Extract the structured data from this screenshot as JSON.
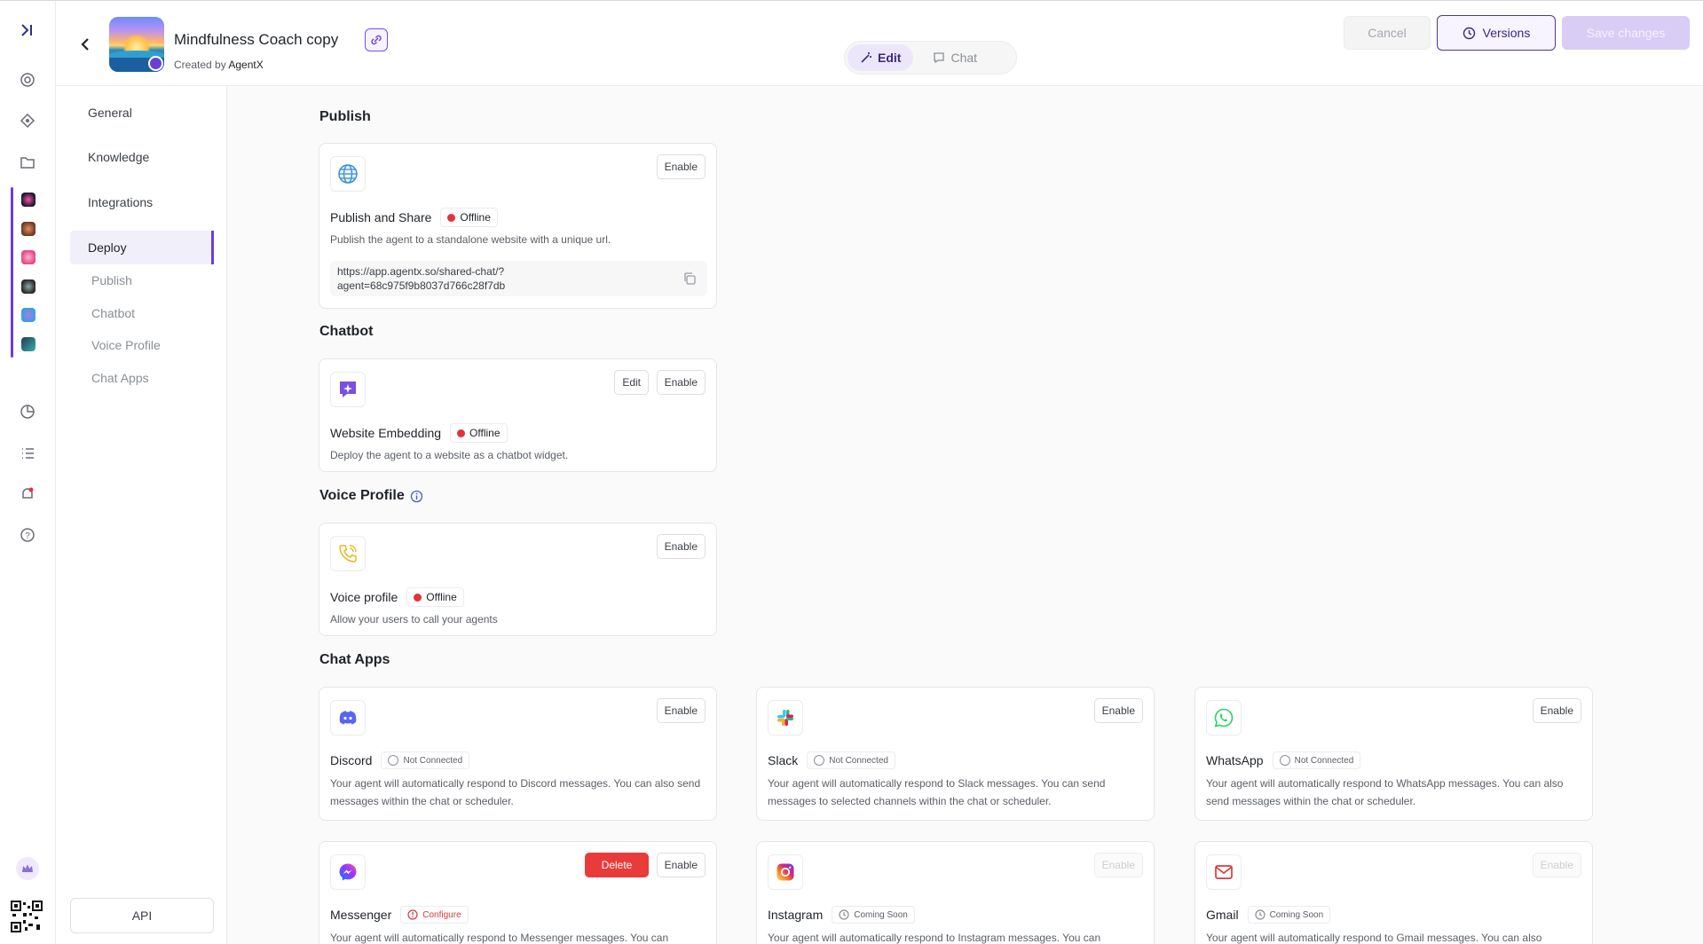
{
  "header": {
    "agent_name": "Mindfulness Coach copy",
    "created_prefix": "Created by",
    "created_by": "AgentX",
    "mode_edit": "Edit",
    "mode_chat": "Chat",
    "cancel": "Cancel",
    "versions": "Versions",
    "save": "Save changes"
  },
  "subnav": {
    "items": [
      "General",
      "Knowledge",
      "Integrations",
      "Deploy"
    ],
    "deploy_subitems": [
      "Publish",
      "Chatbot",
      "Voice Profile",
      "Chat Apps"
    ],
    "api": "API"
  },
  "sections": {
    "publish": "Publish",
    "chatbot": "Chatbot",
    "voice_profile": "Voice Profile",
    "chat_apps": "Chat Apps"
  },
  "cards": {
    "publish_share": {
      "name": "Publish and Share",
      "status": "Offline",
      "desc": "Publish the agent to a standalone website with a unique url.",
      "url_line1": "https://app.agentx.so/shared-chat/?",
      "url_line2": "agent=68c975f9b8037d766c28f7db",
      "enable": "Enable"
    },
    "website_embedding": {
      "name": "Website Embedding",
      "status": "Offline",
      "desc": "Deploy the agent to a website as a chatbot widget.",
      "edit": "Edit",
      "enable": "Enable"
    },
    "voice_profile": {
      "name": "Voice profile",
      "status": "Offline",
      "desc": "Allow your users to call your agents",
      "enable": "Enable"
    },
    "discord": {
      "name": "Discord",
      "status": "Not Connected",
      "desc": "Your agent will automatically respond to Discord messages. You can also send messages within the chat or scheduler.",
      "enable": "Enable"
    },
    "slack": {
      "name": "Slack",
      "status": "Not Connected",
      "desc": "Your agent will automatically respond to Slack messages. You can send messages to selected channels within the chat or scheduler.",
      "enable": "Enable"
    },
    "whatsapp": {
      "name": "WhatsApp",
      "status": "Not Connected",
      "desc": "Your agent will automatically respond to WhatsApp messages. You can also send messages within the chat or scheduler.",
      "enable": "Enable"
    },
    "messenger": {
      "name": "Messenger",
      "status": "Configure",
      "desc": "Your agent will automatically respond to Messenger messages. You can",
      "delete": "Delete",
      "enable": "Enable"
    },
    "instagram": {
      "name": "Instagram",
      "status": "Coming Soon",
      "desc": "Your agent will automatically respond to Instagram messages. You can",
      "enable": "Enable"
    },
    "gmail": {
      "name": "Gmail",
      "status": "Coming Soon",
      "desc": "Your agent will automatically respond to Gmail messages. You can also",
      "enable": "Enable"
    }
  },
  "colors": {
    "accent": "#6b3fd4",
    "offline": "#e2333a",
    "danger": "#ea3b3b"
  }
}
